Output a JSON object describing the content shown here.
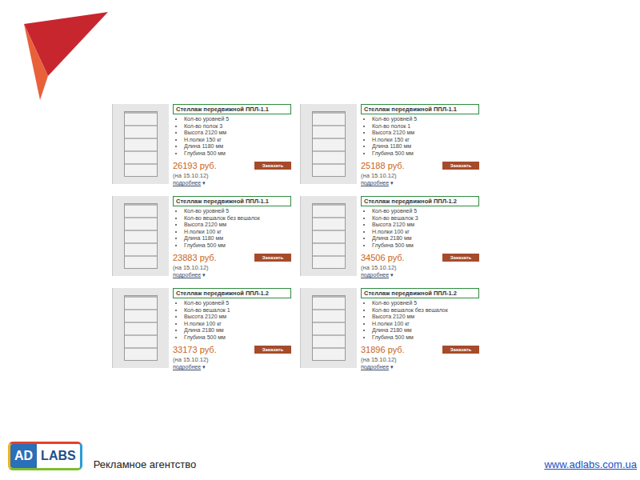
{
  "slide": {
    "cards": [
      {
        "title": "Стеллаж передвижной ППЛ-1.1",
        "specs": [
          "Кол-во уровней 5",
          "Кол-во полок 3",
          "Высота 2120 мм",
          "Н.полки 150 кг",
          "Длина 1180 мм",
          "Глубина 500 мм"
        ],
        "price": "26193 руб.",
        "date": "(на 15.10.12)",
        "more": "подробнее",
        "more_icon": "▾",
        "button": "Заказать"
      },
      {
        "title": "Стеллаж передвижной ППЛ-1.1",
        "specs": [
          "Кол-во уровней 5",
          "Кол-во полок 1",
          "Высота 2120 мм",
          "Н.полки 150 кг",
          "Длина 1180 мм",
          "Глубина 500 мм"
        ],
        "price": "25188 руб.",
        "date": "(на 15.10.12)",
        "more": "подробнее",
        "more_icon": "▾",
        "button": "Заказать"
      },
      {
        "title": "Стеллаж передвижной ППЛ-1.1",
        "specs": [
          "Кол-во уровней 5",
          "Кол-во вешалок без вешалок",
          "Высота 2120 мм",
          "Н.полки 100 кг",
          "Длина 1180 мм",
          "Глубина 500 мм"
        ],
        "price": "23883 руб.",
        "date": "(на 15.10.12)",
        "more": "подробнее",
        "more_icon": "▾",
        "button": "Заказать"
      },
      {
        "title": "Стеллаж передвижной ППЛ-1.2",
        "specs": [
          "Кол-во уровней 5",
          "Кол-во вешалок 3",
          "Высота 2120 мм",
          "Н.полки 100 кг",
          "Длина 2180 мм",
          "Глубина 500 мм"
        ],
        "price": "34506 руб.",
        "date": "(на 15.10.12)",
        "more": "подробнее",
        "more_icon": "▾",
        "button": "Заказать"
      },
      {
        "title": "Стеллаж передвижной ППЛ-1.2",
        "specs": [
          "Кол-во уровней 5",
          "Кол-во вешалок 1",
          "Высота 2120 мм",
          "Н.полки 100 кг",
          "Длина 2180 мм",
          "Глубина 500 мм"
        ],
        "price": "33173 руб.",
        "date": "(на 15.10.12)",
        "more": "подробнее",
        "more_icon": "▾",
        "button": "Заказать"
      },
      {
        "title": "Стеллаж передвижной ППЛ-1.2",
        "specs": [
          "Кол-во уровней 5",
          "Кол-во вешалок без вешалок",
          "Высота 2120 мм",
          "Н.полки 100 кг",
          "Длина 2180 мм",
          "Глубина 500 мм"
        ],
        "price": "31896 руб.",
        "date": "(на 15.10.12)",
        "more": "подробнее",
        "more_icon": "▾",
        "button": "Заказать"
      }
    ]
  },
  "footer": {
    "logo": [
      "AD",
      "LABS"
    ],
    "caption": "Рекламное агентство",
    "url": "www.adlabs.com.ua"
  }
}
